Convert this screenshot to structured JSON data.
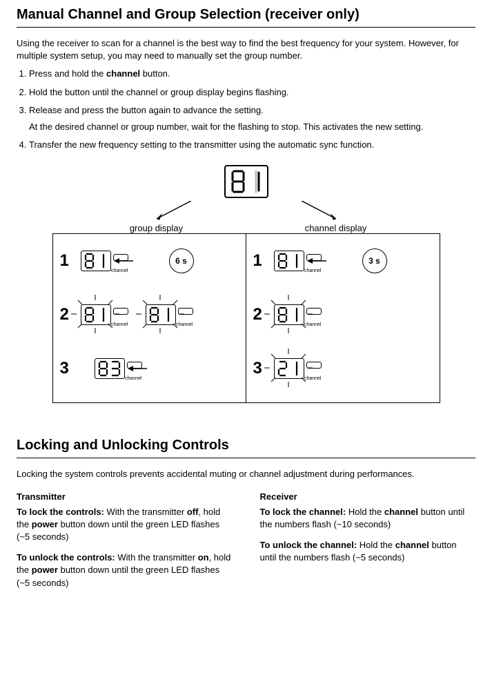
{
  "section1": {
    "title": "Manual Channel and Group Selection (receiver only)",
    "intro": "Using the receiver to scan for a channel is the best way to find the best frequency for your system. However, for multiple system setup, you may need to manually set the group number.",
    "steps": [
      "Press and hold the channel button.",
      "Hold the button until the channel or group display begins flashing.",
      "Release and press the button again to advance the setting.",
      "Transfer the new frequency setting to the transmitter using the automatic sync function."
    ],
    "step3_note": "At the desired channel or group number, wait for the flashing to stop. This activates the new setting.",
    "channel_word": "channel"
  },
  "diagram": {
    "top_digits": "01",
    "label_left": "group display",
    "label_right": "channel display",
    "sub_label": "channel",
    "left": {
      "steps": [
        "1",
        "2",
        "3"
      ],
      "hold_time": "6 s",
      "row1_digits": "01",
      "row2a_digits": "01",
      "row2b_digits": "01",
      "row3_digits": "03"
    },
    "right": {
      "steps": [
        "1",
        "2",
        "3"
      ],
      "hold_time": "3 s",
      "row1_digits": "01",
      "row2_digits": "01",
      "row3_digits": "21"
    }
  },
  "section2": {
    "title": "Locking and Unlocking Controls",
    "intro": "Locking the system controls prevents accidental muting or channel adjustment during performances.",
    "transmitter": {
      "heading": "Transmitter",
      "lock_label": "To lock the controls:",
      "lock_text": " With the transmitter off, hold the power button down until the green LED flashes (~5 seconds)",
      "unlock_label": "To unlock the controls:",
      "unlock_text": " With the transmitter on, hold the power button down until the green LED flashes (~5 seconds)"
    },
    "receiver": {
      "heading": "Receiver",
      "lock_label": "To lock the channel:",
      "lock_text": " Hold the channel button until the numbers flash (~10 seconds)",
      "unlock_label": "To unlock the channel:",
      "unlock_text": " Hold the channel button until the numbers flash (~5 seconds)"
    }
  }
}
